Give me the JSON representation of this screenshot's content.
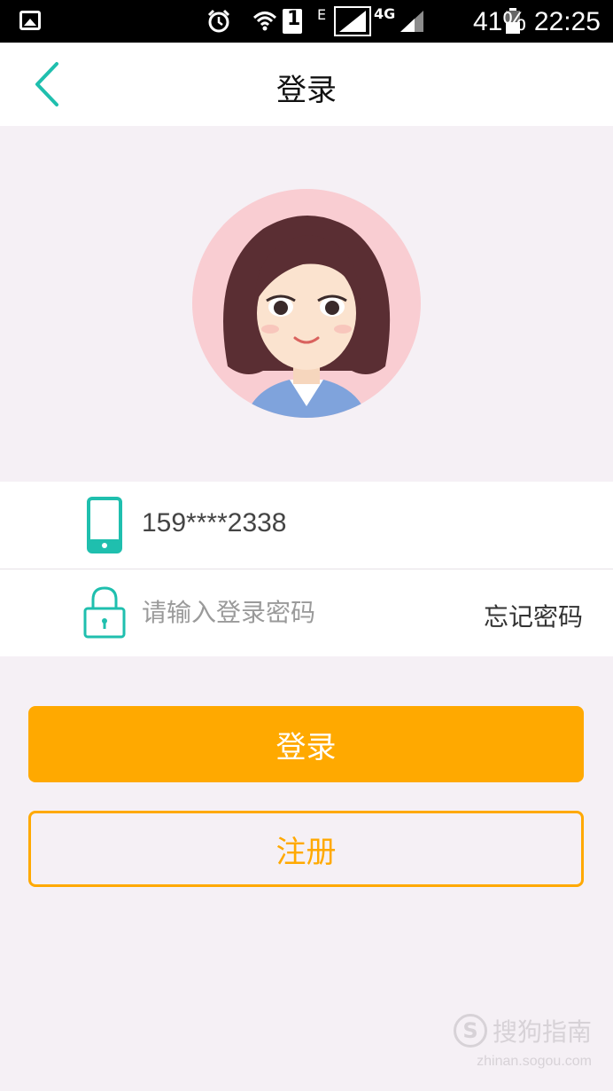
{
  "status_bar": {
    "sim": "1",
    "network_e": "E",
    "network_4g": "4G",
    "battery": "41%",
    "time": "22:25",
    "icons": [
      "gallery-icon",
      "alarm-icon",
      "wifi-icon",
      "sim-icon",
      "signal-icon",
      "battery-icon"
    ]
  },
  "header": {
    "title": "登录",
    "back_icon": "chevron-left-icon"
  },
  "form": {
    "phone_icon": "mobile-phone-icon",
    "phone_value": "159****2338",
    "lock_icon": "lock-icon",
    "password_placeholder": "请输入登录密码",
    "forgot_label": "忘记密码"
  },
  "buttons": {
    "login_label": "登录",
    "register_label": "注册"
  },
  "watermark": {
    "logo_text": "搜狗指南",
    "logo_letter": "S",
    "url": "zhinan.sogou.com"
  },
  "colors": {
    "accent": "#1fbfae",
    "primary": "#ffa900",
    "background": "#f5f0f5",
    "avatar_bg": "#f9cdd2"
  }
}
